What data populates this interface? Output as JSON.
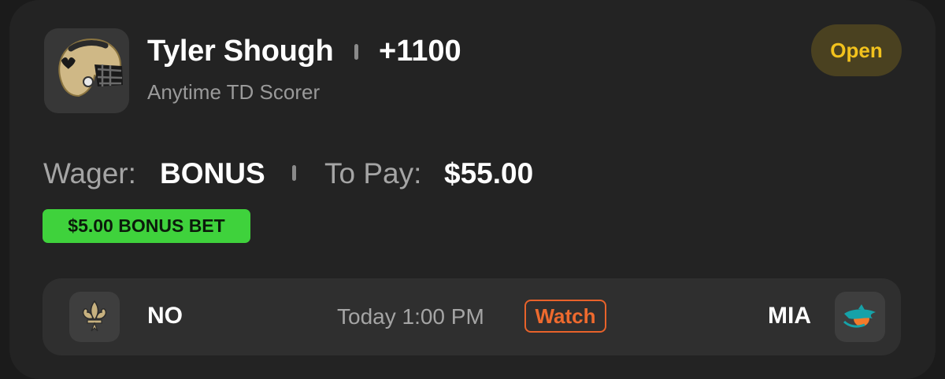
{
  "bet": {
    "player_name": "Tyler Shough",
    "odds": "+1100",
    "market": "Anytime TD Scorer",
    "status": "Open",
    "player_logo_icon": "saints-helmet-icon"
  },
  "wager": {
    "wager_label": "Wager:",
    "wager_value": "BONUS",
    "to_pay_label": "To Pay:",
    "to_pay_value": "$55.00",
    "bonus_badge": "$5.00 BONUS BET"
  },
  "game": {
    "home_abbr": "NO",
    "home_logo_icon": "fleur-de-lis-icon",
    "time": "Today 1:00 PM",
    "watch_label": "Watch",
    "away_abbr": "MIA",
    "away_logo_icon": "dolphin-icon"
  },
  "colors": {
    "card_bg": "#232323",
    "status_text": "#f2c21d",
    "bonus_green": "#3fd23c",
    "watch_orange": "#ee6a2e"
  }
}
